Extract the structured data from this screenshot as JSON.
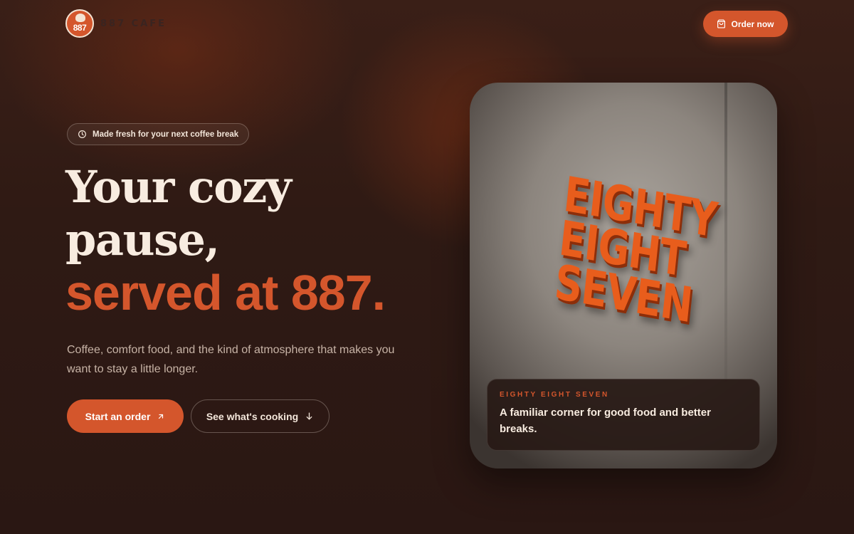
{
  "header": {
    "logo_text": "887",
    "brand_name": "887 CAFE",
    "order_button": {
      "label": "Order now",
      "icon": "shopping-bag-icon"
    }
  },
  "hero": {
    "badge": {
      "icon": "clock-icon",
      "text": "Made fresh for your next coffee break"
    },
    "headline": {
      "line1": "Your cozy",
      "line2": "pause,",
      "accent": "served at 887."
    },
    "subtext": "Coffee, comfort food, and the kind of atmosphere that makes you want to stay a little longer.",
    "primary_button": {
      "label": "Start an order",
      "icon": "arrow-up-right-icon"
    },
    "secondary_button": {
      "label": "See what's cooking",
      "icon": "arrow-down-icon"
    }
  },
  "card": {
    "sign_lines": [
      "EIGHTY",
      "EIGHT",
      "SEVEN"
    ],
    "kicker": "EIGHTY EIGHT SEVEN",
    "caption": "A familiar corner for good food and better breaks."
  },
  "colors": {
    "accent": "#d4562c",
    "background": "#2f1a14",
    "text": "#f3e6da"
  }
}
